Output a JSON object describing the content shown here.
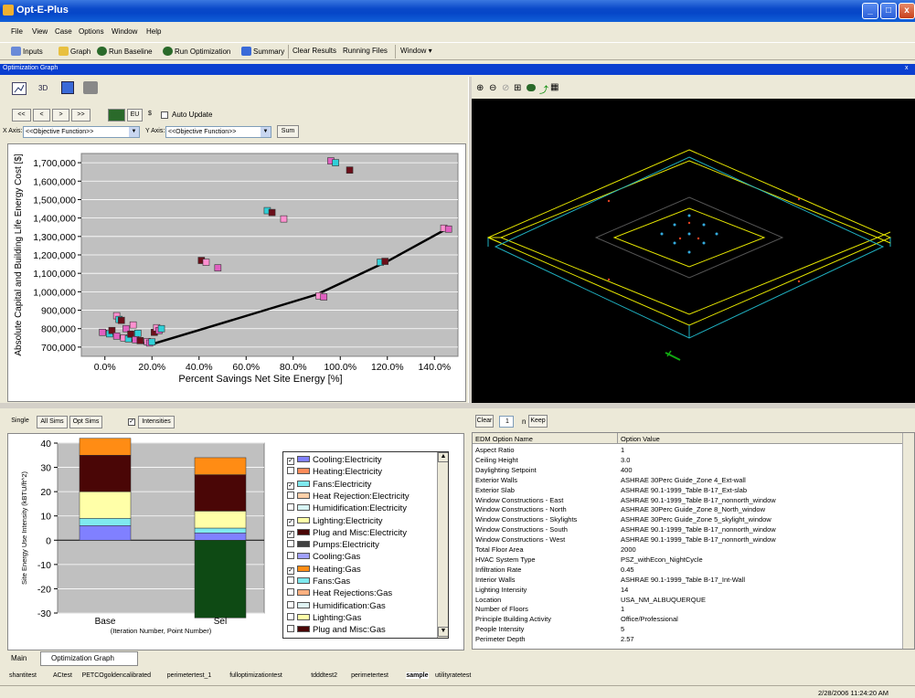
{
  "app": {
    "title": "Opt-E-Plus"
  },
  "menu": [
    "File",
    "View",
    "Case",
    "Options",
    "Window",
    "Help"
  ],
  "toolbar": {
    "inputs": "Inputs",
    "graph": "Graph",
    "run_baseline": "Run Baseline",
    "run_optimization": "Run Optimization",
    "summary": "Summary",
    "clear_results": "Clear Results",
    "running_files": "Running Files",
    "window": "Window ▾"
  },
  "panel_title": "Optimization Graph",
  "graph_controls": {
    "nav": [
      "<<",
      "<",
      ">",
      ">>"
    ],
    "eu": "EU",
    "dollar": "$",
    "auto_update": "Auto Update",
    "x_axis_label": "X Axis:",
    "x_axis_value": "<<Objective Function>>",
    "y_axis_label": "Y Axis:",
    "y_axis_value": "<<Objective Function>>",
    "sum": "Sum"
  },
  "chart_data": [
    {
      "type": "scatter",
      "xlabel": "Percent Savings Net Site Energy [%]",
      "ylabel": "Absolute Capital and Building Life Energy Cost [$]",
      "xlim": [
        -10,
        150
      ],
      "ylim": [
        650000,
        1750000
      ],
      "x_ticks": [
        "0.0%",
        "20.0%",
        "40.0%",
        "60.0%",
        "80.0%",
        "100.0%",
        "120.0%",
        "140.0%"
      ],
      "y_ticks": [
        "700,000",
        "800,000",
        "900,000",
        "1,000,000",
        "1,100,000",
        "1,200,000",
        "1,300,000",
        "1,400,000",
        "1,500,000",
        "1,600,000",
        "1,700,000"
      ],
      "series": [
        {
          "values": [
            [
              -1,
              780000
            ],
            [
              2,
              772000
            ],
            [
              3,
              790000
            ],
            [
              5,
              870000
            ],
            [
              5,
              760000
            ],
            [
              6,
              850000
            ],
            [
              7,
              845000
            ],
            [
              8,
              750000
            ],
            [
              9,
              800000
            ],
            [
              10,
              745000
            ],
            [
              11,
              770000
            ],
            [
              12,
              820000
            ],
            [
              13,
              740000
            ],
            [
              14,
              775000
            ],
            [
              15,
              735000
            ],
            [
              18,
              730000
            ],
            [
              19,
              722000
            ],
            [
              20,
              728000
            ],
            [
              21,
              780000
            ],
            [
              22,
              805000
            ],
            [
              23,
              790000
            ],
            [
              24,
              800000
            ],
            [
              41,
              1170000
            ],
            [
              43,
              1160000
            ],
            [
              48,
              1130000
            ],
            [
              69,
              1440000
            ],
            [
              71,
              1430000
            ],
            [
              76,
              1395000
            ],
            [
              96,
              1710000
            ],
            [
              98,
              1700000
            ],
            [
              104,
              1660000
            ],
            [
              91,
              978000
            ],
            [
              93,
              972000
            ],
            [
              117,
              1160000
            ],
            [
              119,
              1165000
            ],
            [
              144,
              1345000
            ],
            [
              146,
              1340000
            ]
          ]
        },
        {
          "name": "frontier",
          "type": "line",
          "values": [
            [
              0,
              790000
            ],
            [
              10,
              740000
            ],
            [
              15,
              725000
            ],
            [
              20,
              716000
            ],
            [
              40,
              792000
            ],
            [
              90,
              985000
            ],
            [
              120,
              1165000
            ],
            [
              145,
              1340000
            ]
          ]
        }
      ]
    },
    {
      "type": "bar",
      "ylabel": "Site Energy Use Intensity (kBTU/ft^2)",
      "xlabel": "(Iteration Number, Point Number)",
      "categories": [
        "Base",
        "Sel"
      ],
      "ylim": [
        -30,
        40
      ],
      "y_ticks": [
        "40",
        "30",
        "20",
        "10",
        "0",
        "-10",
        "-20",
        "-30"
      ],
      "series": [
        {
          "name": "Cooling:Electricity",
          "color": "#8080ff",
          "values": [
            6,
            3
          ]
        },
        {
          "name": "Fans:Electricity",
          "color": "#7fe9ef",
          "values": [
            3,
            2
          ]
        },
        {
          "name": "Lighting:Electricity",
          "color": "#ffffa8",
          "values": [
            11,
            7
          ]
        },
        {
          "name": "Plug and Misc:Electricity",
          "color": "#4a0606",
          "values": [
            15,
            15
          ]
        },
        {
          "name": "Heating:Gas",
          "color": "#ff8c14",
          "values": [
            7,
            7
          ]
        },
        {
          "name": "Heating:Electricity (negative)",
          "color": "#0e4a14",
          "values": [
            0,
            -32
          ]
        }
      ]
    }
  ],
  "tabs_mid": {
    "single": "Single",
    "all_sims": "All Sims",
    "opt_sims": "Opt Sims",
    "intensities": "Intensities"
  },
  "legend": [
    {
      "label": "Cooling:Electricity",
      "checked": true,
      "color": "#8080ff"
    },
    {
      "label": "Heating:Electricity",
      "checked": false,
      "color": "#ff8c5a"
    },
    {
      "label": "Fans:Electricity",
      "checked": true,
      "color": "#7fe9ef"
    },
    {
      "label": "Heat Rejection:Electricity",
      "checked": false,
      "color": "#ffd0a8"
    },
    {
      "label": "Humidification:Electricity",
      "checked": false,
      "color": "#d8f4f4"
    },
    {
      "label": "Lighting:Electricity",
      "checked": true,
      "color": "#ffffa8"
    },
    {
      "label": "Plug and Misc:Electricity",
      "checked": true,
      "color": "#4a0606"
    },
    {
      "label": "Pumps:Electricity",
      "checked": false,
      "color": "#404040"
    },
    {
      "label": "Cooling:Gas",
      "checked": false,
      "color": "#a0a0ff"
    },
    {
      "label": "Heating:Gas",
      "checked": true,
      "color": "#ff8c14"
    },
    {
      "label": "Fans:Gas",
      "checked": false,
      "color": "#7fe9ef"
    },
    {
      "label": "Heat Rejections:Gas",
      "checked": false,
      "color": "#ffb080"
    },
    {
      "label": "Humidification:Gas",
      "checked": false,
      "color": "#e0f4f4"
    },
    {
      "label": "Lighting:Gas",
      "checked": false,
      "color": "#ffffa8"
    },
    {
      "label": "Plug and Misc:Gas",
      "checked": false,
      "color": "#4a0606"
    }
  ],
  "right_controls": {
    "clear": "Clear",
    "value": "1",
    "n": "n",
    "keep": "Keep"
  },
  "table": {
    "headers": [
      "EDM Option Name",
      "Option Value"
    ],
    "rows": [
      [
        "Aspect Ratio",
        "1"
      ],
      [
        "Ceiling Height",
        "3.0"
      ],
      [
        "Daylighting Setpoint",
        "400"
      ],
      [
        "Exterior Walls",
        "ASHRAE 30Perc Guide_Zone 4_Ext-wall"
      ],
      [
        "Exterior Slab",
        "ASHRAE 90.1-1999_Table B-17_Ext-slab"
      ],
      [
        "Window Constructions - East",
        "ASHRAE 90.1-1999_Table B-17_nonnorth_window"
      ],
      [
        "Window Constructions - North",
        "ASHRAE 30Perc Guide_Zone 8_North_window"
      ],
      [
        "Window Constructions - Skylights",
        "ASHRAE 30Perc Guide_Zone 5_skylight_window"
      ],
      [
        "Window Constructions - South",
        "ASHRAE 90.1-1999_Table B-17_nonnorth_window"
      ],
      [
        "Window Constructions - West",
        "ASHRAE 90.1-1999_Table B-17_nonnorth_window"
      ],
      [
        "Total Floor Area",
        "2000"
      ],
      [
        "HVAC System Type",
        "PSZ_withEcon_NightCycle"
      ],
      [
        "Infiltration Rate",
        "0.45"
      ],
      [
        "Interior Walls",
        "ASHRAE 90.1-1999_Table B-17_Int-Wall"
      ],
      [
        "Lighting Intensity",
        "14"
      ],
      [
        "Location",
        "USA_NM_ALBUQUERQUE"
      ],
      [
        "Number of Floors",
        "1"
      ],
      [
        "Principle Building Activity",
        "Office/Professional"
      ],
      [
        "People Intensity",
        "5"
      ],
      [
        "Perimeter Depth",
        "2.57"
      ]
    ]
  },
  "bottom_tabs": [
    "Main",
    "Optimization Graph"
  ],
  "file_tabs": [
    "shantitest",
    "ACtest",
    "PETCOgoldencalibrated",
    "perimetertest_1",
    "fulloptimizationtest",
    "tdddtest2",
    "perimetertest",
    "sample",
    "utilityratetest"
  ],
  "status": {
    "datetime": "2/28/2006 11:24:20 AM"
  }
}
